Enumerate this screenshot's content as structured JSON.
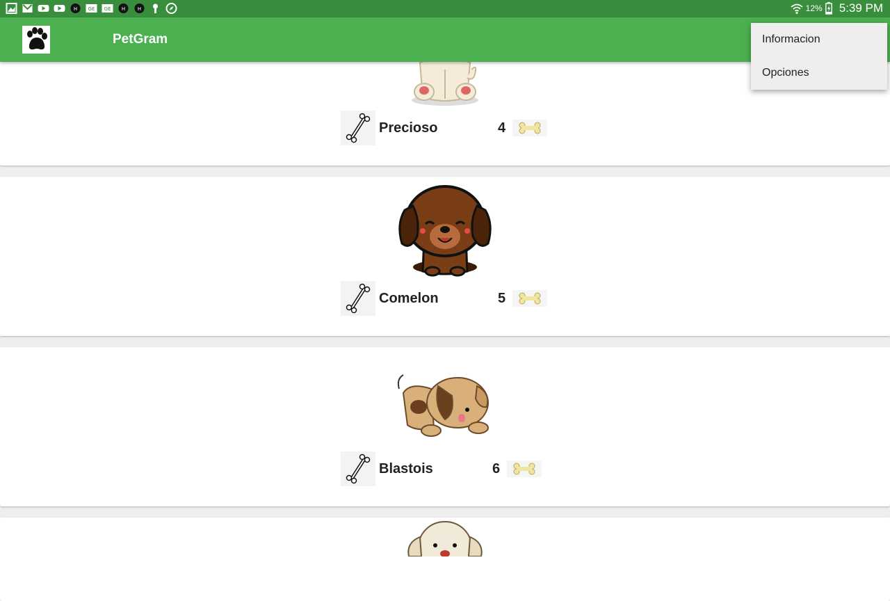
{
  "status_bar": {
    "notification_icons": [
      "image-icon",
      "gmail-icon",
      "youtube-icon",
      "youtube-icon",
      "hangouts-icon",
      "ge-icon",
      "ge-icon",
      "hangouts-icon",
      "hangouts-icon",
      "keyhole-icon",
      "compass-icon"
    ],
    "battery": "12%",
    "time": "5:39 PM"
  },
  "app_bar": {
    "title": "PetGram",
    "logo_icon": "paw-icon",
    "color": "#4caf50"
  },
  "menu": {
    "items": [
      {
        "label": "Informacion"
      },
      {
        "label": "Opciones"
      }
    ]
  },
  "pets": [
    {
      "name": "Precioso",
      "rating": "4",
      "image": "cream-puppy-sitting"
    },
    {
      "name": "Comelon",
      "rating": "5",
      "image": "brown-puppy-sitting"
    },
    {
      "name": "Blastois",
      "rating": "6",
      "image": "spotted-puppy-playing"
    },
    {
      "name": "",
      "rating": "",
      "image": "white-puppy"
    }
  ]
}
